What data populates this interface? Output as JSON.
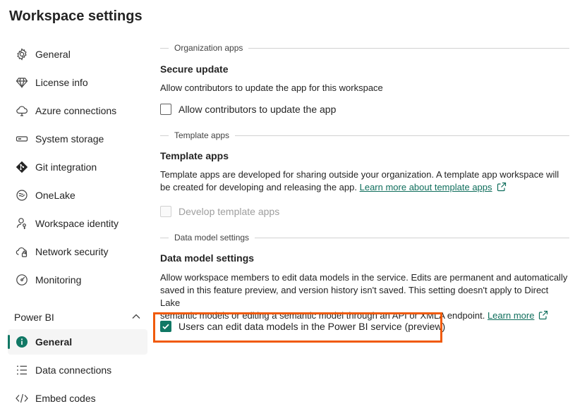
{
  "page": {
    "title": "Workspace settings"
  },
  "sidebar": {
    "items": [
      {
        "label": "General",
        "icon": "gear-icon"
      },
      {
        "label": "License info",
        "icon": "diamond-icon"
      },
      {
        "label": "Azure connections",
        "icon": "cloud-icon"
      },
      {
        "label": "System storage",
        "icon": "storage-icon"
      },
      {
        "label": "Git integration",
        "icon": "git-icon"
      },
      {
        "label": "OneLake",
        "icon": "onelake-icon"
      },
      {
        "label": "Workspace identity",
        "icon": "identity-icon"
      },
      {
        "label": "Network security",
        "icon": "network-icon"
      },
      {
        "label": "Monitoring",
        "icon": "monitoring-icon"
      }
    ],
    "powerbi_section": {
      "label": "Power BI",
      "items": [
        {
          "label": "General",
          "icon": "info-icon",
          "selected": true
        },
        {
          "label": "Data connections",
          "icon": "list-icon"
        },
        {
          "label": "Embed codes",
          "icon": "code-icon"
        }
      ]
    }
  },
  "main": {
    "org_apps": {
      "divider": "Organization apps",
      "title": "Secure update",
      "description": "Allow contributors to update the app for this workspace",
      "checkbox_label": "Allow contributors to update the app",
      "checked": false
    },
    "template_apps": {
      "divider": "Template apps",
      "title": "Template apps",
      "description_line1": "Template apps are developed for sharing outside your organization. A template app workspace will",
      "description_line2": "be created for developing and releasing the app.",
      "link": "Learn more about template apps",
      "checkbox_label": "Develop template apps",
      "checked": false,
      "disabled": true
    },
    "data_model": {
      "divider": "Data model settings",
      "title": "Data model settings",
      "description_line1": "Allow workspace members to edit data models in the service. Edits are permanent and automatically",
      "description_line2": "saved in this feature preview, and version history isn't saved. This setting doesn't apply to Direct Lake",
      "description_line3": "semantic models or editing a semantic model through an API or XMLA endpoint.",
      "link": "Learn more",
      "checkbox_label": "Users can edit data models in the Power BI service (preview)",
      "checked": true
    }
  },
  "colors": {
    "accent": "#117865",
    "link": "#0f6e5c",
    "highlight": "#f05a0a"
  }
}
